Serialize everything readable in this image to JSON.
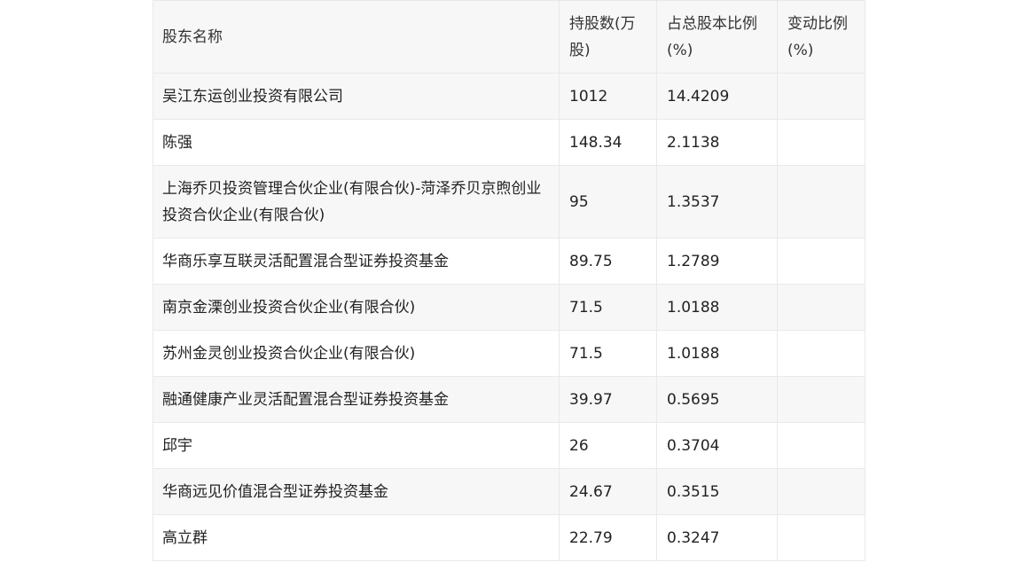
{
  "table": {
    "headers": {
      "name": "股东名称",
      "shares": "持股数(万股)",
      "ratio": "占总股本比例(%)",
      "change": "变动比例(%)"
    },
    "rows": [
      {
        "name": "吴江东运创业投资有限公司",
        "shares": "1012",
        "ratio": "14.4209",
        "change": ""
      },
      {
        "name": "陈强",
        "shares": "148.34",
        "ratio": "2.1138",
        "change": ""
      },
      {
        "name": "上海乔贝投资管理合伙企业(有限合伙)-菏泽乔贝京煦创业投资合伙企业(有限合伙)",
        "shares": "95",
        "ratio": "1.3537",
        "change": ""
      },
      {
        "name": "华商乐享互联灵活配置混合型证券投资基金",
        "shares": "89.75",
        "ratio": "1.2789",
        "change": ""
      },
      {
        "name": "南京金溧创业投资合伙企业(有限合伙)",
        "shares": "71.5",
        "ratio": "1.0188",
        "change": ""
      },
      {
        "name": "苏州金灵创业投资合伙企业(有限合伙)",
        "shares": "71.5",
        "ratio": "1.0188",
        "change": ""
      },
      {
        "name": "融通健康产业灵活配置混合型证券投资基金",
        "shares": "39.97",
        "ratio": "0.5695",
        "change": ""
      },
      {
        "name": "邱宇",
        "shares": "26",
        "ratio": "0.3704",
        "change": ""
      },
      {
        "name": "华商远见价值混合型证券投资基金",
        "shares": "24.67",
        "ratio": "0.3515",
        "change": ""
      },
      {
        "name": "高立群",
        "shares": "22.79",
        "ratio": "0.3247",
        "change": ""
      }
    ]
  }
}
